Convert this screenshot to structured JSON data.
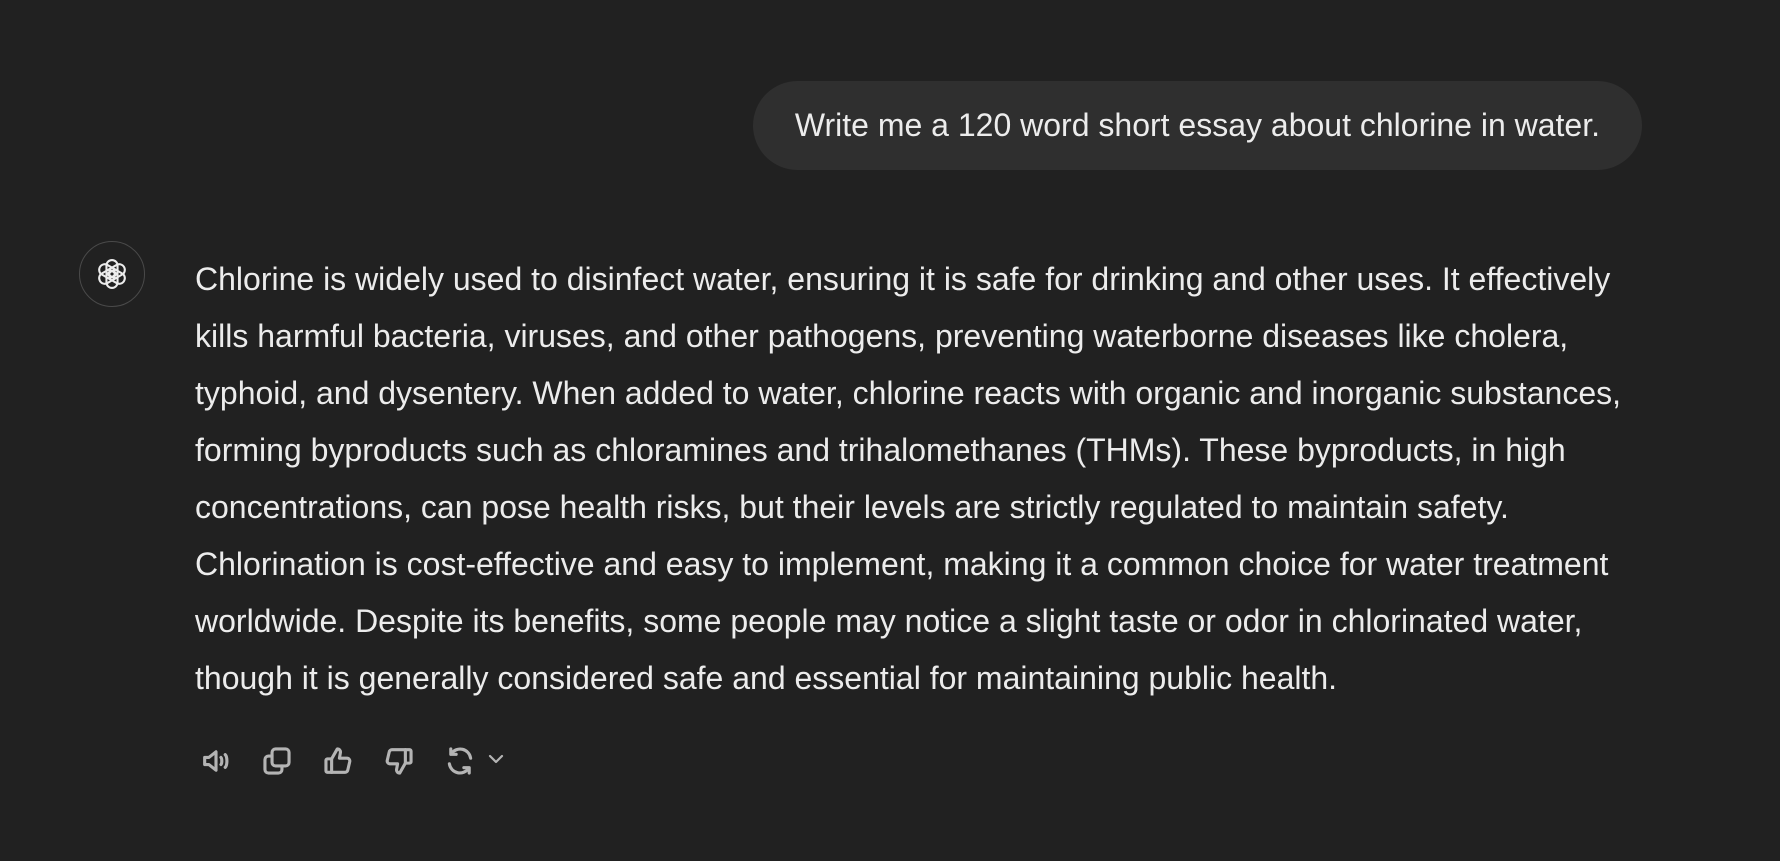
{
  "user_message": {
    "text": "Write me a 120 word short essay about chlorine in water."
  },
  "assistant_message": {
    "avatar_icon": "openai-logo-icon",
    "lines": [
      "Chlorine is widely used to disinfect water, ensuring it is safe for drinking and other uses. It effectively",
      "kills harmful bacteria, viruses, and other pathogens, preventing waterborne diseases like cholera,",
      "typhoid, and dysentery. When added to water, chlorine reacts with organic and inorganic substances,",
      "forming byproducts such as chloramines and trihalomethanes (THMs). These byproducts, in high",
      "concentrations, can pose health risks, but their levels are strictly regulated to maintain safety.",
      "Chlorination is cost-effective and easy to implement, making it a common choice for water treatment",
      "worldwide. Despite its benefits, some people may notice a slight taste or odor in chlorinated water,",
      "though it is generally considered safe and essential for maintaining public health."
    ]
  },
  "actions": [
    {
      "icon": "speaker-icon"
    },
    {
      "icon": "copy-icon"
    },
    {
      "icon": "thumbs-up-icon"
    },
    {
      "icon": "thumbs-down-icon"
    },
    {
      "icon": "regenerate-icon"
    },
    {
      "icon": "chevron-down-icon"
    }
  ],
  "colors": {
    "background": "#212121",
    "user_bubble": "#2f2f2f",
    "text": "#ececec",
    "icon": "#b4b4b4"
  }
}
